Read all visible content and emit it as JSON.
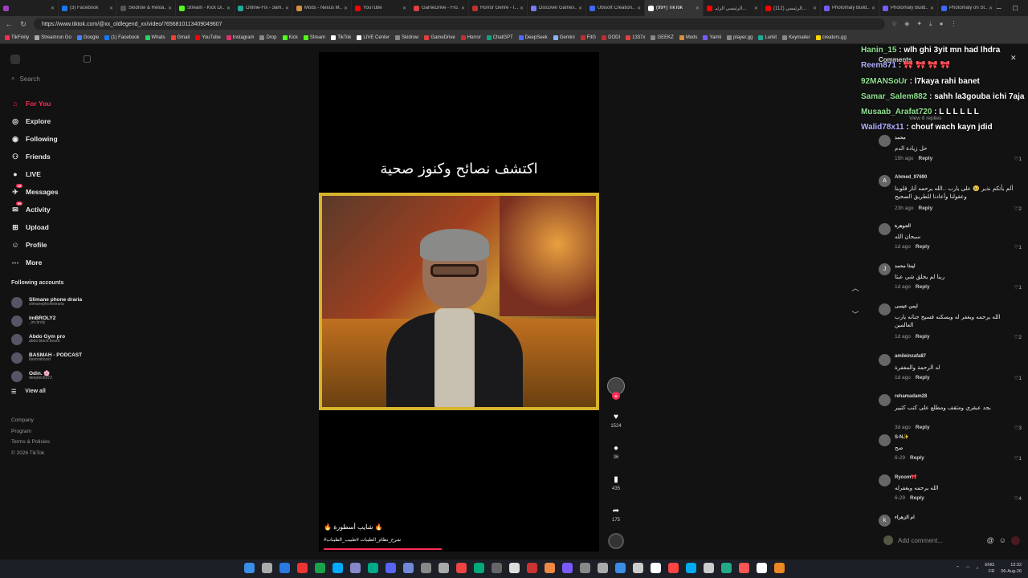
{
  "browser": {
    "tabs": [
      {
        "label": "",
        "color": "#a040c0",
        "active": false
      },
      {
        "label": "(3) Facebook",
        "color": "#1877f2",
        "active": false
      },
      {
        "label": "Skidrow & Reloa...",
        "color": "#555",
        "active": false
      },
      {
        "label": "Stream - Kick Di...",
        "color": "#53fc18",
        "active": false
      },
      {
        "label": "Online-Fix - 3am...",
        "color": "#2a9",
        "active": false
      },
      {
        "label": "Mods - Nexus M...",
        "color": "#d98f40",
        "active": false
      },
      {
        "label": "YouTube",
        "color": "#ff0000",
        "active": false
      },
      {
        "label": "GameDrive - Fro...",
        "color": "#e04040",
        "active": false
      },
      {
        "label": "Horror Genre - I...",
        "color": "#c03030",
        "active": false
      },
      {
        "label": "Discover Games...",
        "color": "#7a7aff",
        "active": false
      },
      {
        "label": "Ubisoft Creation...",
        "color": "#3a6aff",
        "active": false
      },
      {
        "label": "(99+) TikTok",
        "color": "#ffffff",
        "active": true
      },
      {
        "label": "الرئيسي الرئيـ...",
        "color": "#ff0000",
        "active": false
      },
      {
        "label": "(112) الرئيسي...",
        "color": "#ff0000",
        "active": false
      },
      {
        "label": "Photomaly Build...",
        "color": "#7a5aff",
        "active": false
      },
      {
        "label": "Photomaly Build...",
        "color": "#7a5aff",
        "active": false
      },
      {
        "label": "Photomaly on St...",
        "color": "#3a6aff",
        "active": false
      }
    ],
    "url": "https://www.tiktok.com/@xx_oldlegend_xx/video/7656810113409049607",
    "bookmarks": [
      {
        "label": "TikFinity",
        "color": "#fe2c55"
      },
      {
        "label": "Streamrun Go",
        "color": "#aaa"
      },
      {
        "label": "Google",
        "color": "#4285f4"
      },
      {
        "label": "(1) Facebook",
        "color": "#1877f2"
      },
      {
        "label": "Whats",
        "color": "#25d366"
      },
      {
        "label": "Gmail",
        "color": "#ea4335"
      },
      {
        "label": "YouTube",
        "color": "#ff0000"
      },
      {
        "label": "Instagram",
        "color": "#e1306c"
      },
      {
        "label": "Drop",
        "color": "#888"
      },
      {
        "label": "Kick",
        "color": "#53fc18"
      },
      {
        "label": "Stream",
        "color": "#53fc18"
      },
      {
        "label": "TikTok",
        "color": "#ffffff"
      },
      {
        "label": "LIVE Center",
        "color": "#ffffff"
      },
      {
        "label": "Skidrow",
        "color": "#888"
      },
      {
        "label": "GameDrive",
        "color": "#e04040"
      },
      {
        "label": "Horror",
        "color": "#c03030"
      },
      {
        "label": "ChatGPT",
        "color": "#10a37f"
      },
      {
        "label": "DeepSeek",
        "color": "#4d6bfe"
      },
      {
        "label": "Gemini",
        "color": "#8ab4f8"
      },
      {
        "label": "FitG",
        "color": "#c03030"
      },
      {
        "label": "DODI",
        "color": "#c03030"
      },
      {
        "label": "1337x",
        "color": "#e04040"
      },
      {
        "label": "GEEKZ",
        "color": "#888"
      },
      {
        "label": "Mods",
        "color": "#d98f40"
      },
      {
        "label": "Yamli",
        "color": "#7a5aff"
      },
      {
        "label": "player.gg",
        "color": "#888"
      },
      {
        "label": "Lurkit",
        "color": "#2a9"
      },
      {
        "label": "Keymailer",
        "color": "#888"
      },
      {
        "label": "creators.gg",
        "color": "#ffd400"
      }
    ]
  },
  "sidebar": {
    "search_placeholder": "Search",
    "nav": [
      {
        "label": "For You",
        "icon": "home-icon",
        "glyph": "⌂",
        "active": true,
        "badge": ""
      },
      {
        "label": "Explore",
        "icon": "compass-icon",
        "glyph": "◎",
        "active": false,
        "badge": ""
      },
      {
        "label": "Following",
        "icon": "following-icon",
        "glyph": "◉",
        "active": false,
        "badge": ""
      },
      {
        "label": "Friends",
        "icon": "friends-icon",
        "glyph": "⚇",
        "active": false,
        "badge": ""
      },
      {
        "label": "LIVE",
        "icon": "live-icon",
        "glyph": "●",
        "active": false,
        "badge": ""
      },
      {
        "label": "Messages",
        "icon": "messages-icon",
        "glyph": "✈",
        "active": false,
        "badge": "15"
      },
      {
        "label": "Activity",
        "icon": "activity-icon",
        "glyph": "✉",
        "active": false,
        "badge": "99"
      },
      {
        "label": "Upload",
        "icon": "upload-icon",
        "glyph": "⊞",
        "active": false,
        "badge": ""
      },
      {
        "label": "Profile",
        "icon": "profile-icon",
        "glyph": "☺",
        "active": false,
        "badge": ""
      },
      {
        "label": "More",
        "icon": "more-icon",
        "glyph": "⋯",
        "active": false,
        "badge": ""
      }
    ],
    "following_heading": "Following accounts",
    "following": [
      {
        "name": "Slimane phone draria",
        "handle": "slimanephonedraria"
      },
      {
        "name": "imBROLY2",
        "handle": "_im.broly"
      },
      {
        "name": "Abdo Gym pro",
        "handle": "abdo.black.beard"
      },
      {
        "name": "BASMAH - PODCAST",
        "handle": "basmahcast"
      },
      {
        "name": "Odin. 🌸",
        "handle": "deeptech072"
      }
    ],
    "view_all": "View all",
    "footer": [
      "Company",
      "Program",
      "Terms & Policies",
      "© 2026 TikTok"
    ]
  },
  "video": {
    "overlay_title": "اكتشف نصائح وكنوز صحية",
    "caption": "🔥 شايب أسطورة 🔥",
    "hashtags": "#شرح_نظام_الطيبات #طبيب_الطيبات",
    "progress_fraction": 0.42,
    "likes": "1524",
    "comments": "36",
    "saves": "435",
    "shares": "175"
  },
  "live_chat": [
    {
      "user": "Hanin_15",
      "msg": "wlh ghi 3yit mn had lhdra",
      "color": "#8fe08f"
    },
    {
      "user": "Reem871",
      "msg": "🎀 🎀 🎀 🎀",
      "color": "#b0b0ff"
    },
    {
      "user": "92MANSoUr",
      "msg": "l7kaya rahi banet",
      "color": "#8fe08f"
    },
    {
      "user": "Samar_Salem882",
      "msg": "sahh la3gouba ichi 7aja",
      "color": "#8fe08f"
    },
    {
      "user": "Musaab_Arafat720",
      "msg": "L L L L L L",
      "color": "#8fe08f"
    },
    {
      "user": "Walid78x11",
      "msg": "chouf wach kayn jdid",
      "color": "#b0b0ff"
    }
  ],
  "comments_panel": {
    "title": "Comments",
    "view_replies": "View 8 replies",
    "input_placeholder": "Add comment...",
    "reply_label": "Reply",
    "items": [
      {
        "user": "محمد",
        "avatar": "",
        "text": "حل زيادة الدم",
        "time": "15h ago",
        "likes": "1"
      },
      {
        "user": "Ahmed_97690",
        "avatar": "A",
        "text": "ألم يأتكم نذير 🥹 على يارب ..الله يرحمه أنار قلوبنا وعقولنا وأعادنا للطريق الصحيح",
        "time": "23h ago",
        "likes": "2"
      },
      {
        "user": "الجوهرة",
        "avatar": "",
        "text": "سبحان الله",
        "time": "1d ago",
        "likes": "1"
      },
      {
        "user": "لينذا محمد",
        "avatar": "J",
        "text": "ربنا لم يخلق شي عبثا",
        "time": "1d ago",
        "likes": "1"
      },
      {
        "user": "ايمن عيسى",
        "avatar": "",
        "text": "الله يرحمه ويغفر له ويسكنه فسيح جناته يارب العالمين",
        "time": "1d ago",
        "likes": "2"
      },
      {
        "user": "amileinzafa87",
        "avatar": "",
        "text": "له الرحمة والمغفرة",
        "time": "1d ago",
        "likes": "1"
      },
      {
        "user": "rehamadam28",
        "avatar": "",
        "text": "بجد عبقري ومثقف ومطلع على كتب كثيير",
        "time": "3d ago",
        "likes": "3"
      },
      {
        "user": "S-N✨",
        "avatar": "",
        "text": "صح",
        "time": "6-29",
        "likes": "1"
      },
      {
        "user": "Ryoom🎀",
        "avatar": "",
        "text": "الله يرحمه ويغفرله",
        "time": "6-29",
        "likes": "4"
      },
      {
        "user": "ام الزهراء",
        "avatar": "k",
        "text": "",
        "time": "",
        "likes": ""
      }
    ]
  },
  "taskbar": {
    "lang": "ENG",
    "region": "FR",
    "time": "13:32",
    "date": "06-Aug-26"
  }
}
